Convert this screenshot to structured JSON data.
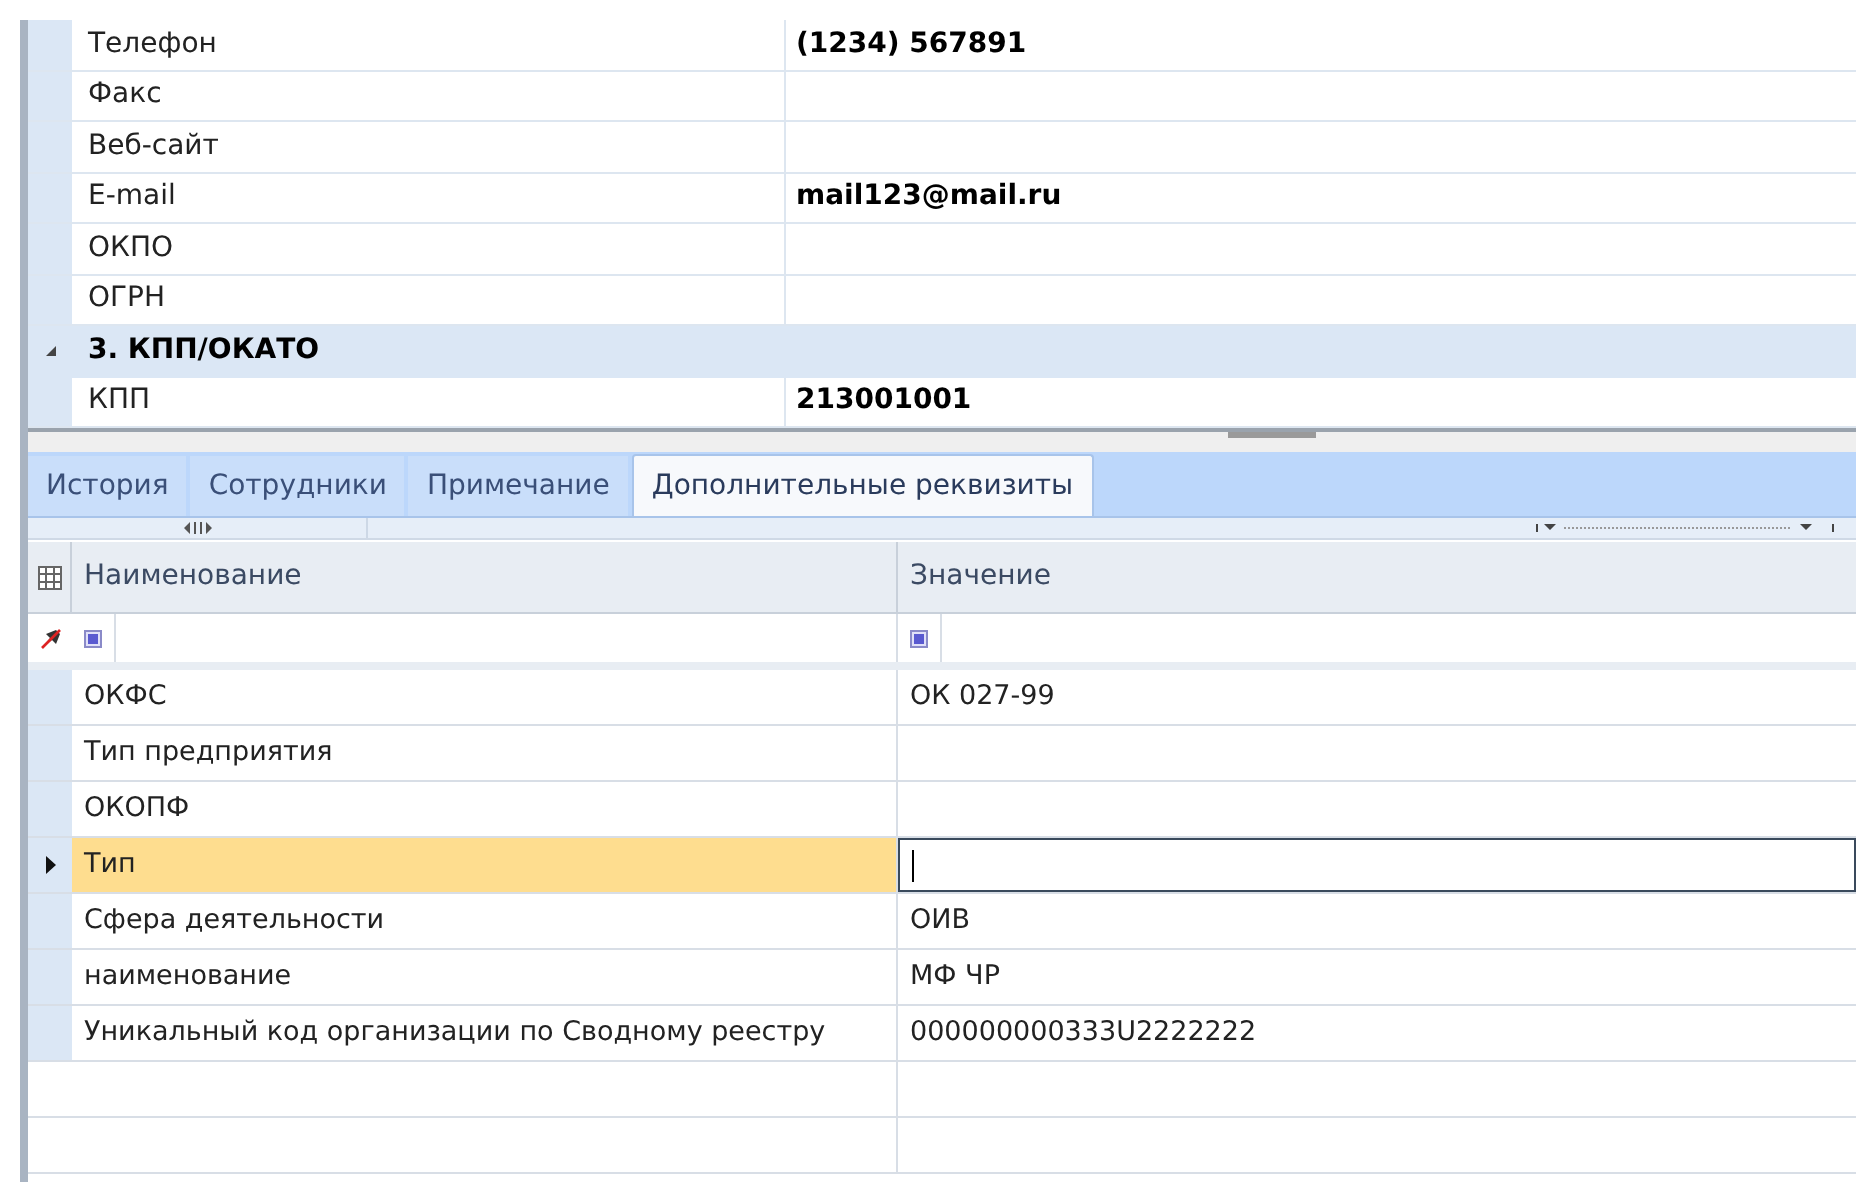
{
  "top_grid": {
    "rows": [
      {
        "kind": "field",
        "name": "Телефон",
        "value": "(1234) 567891"
      },
      {
        "kind": "field",
        "name": "Факс"
      },
      {
        "kind": "field",
        "name": "Веб-сайт"
      },
      {
        "kind": "field",
        "name": "E-mail",
        "value": "mail123@mail.ru"
      },
      {
        "kind": "field",
        "name": "ОКПО"
      },
      {
        "kind": "field",
        "name": "ОГРН"
      },
      {
        "kind": "group",
        "name": "3. КПП/ОКАТО",
        "expanded": true
      },
      {
        "kind": "field",
        "name": "КПП",
        "value": "213001001"
      }
    ]
  },
  "tabs": [
    {
      "label": "История",
      "selected": false
    },
    {
      "label": "Сотрудники",
      "selected": false
    },
    {
      "label": "Примечание",
      "selected": false
    },
    {
      "label": "Дополнительные реквизиты",
      "selected": true
    }
  ],
  "grid": {
    "columns": [
      "Наименование",
      "Значение"
    ],
    "rows": [
      {
        "name": "ОКФС",
        "value": "ОК 027-99",
        "selected": false
      },
      {
        "name": "Тип предприятия",
        "selected": false
      },
      {
        "name": "ОКОПФ",
        "selected": false
      },
      {
        "name": "Тип",
        "selected": true
      },
      {
        "name": "Сфера деятельности",
        "value": "ОИВ",
        "selected": false
      },
      {
        "name": "наименование",
        "value": "МФ ЧР",
        "selected": false
      },
      {
        "name": "Уникальный код организации по Сводному реестру",
        "value": "000000000333U2222222",
        "selected": false
      }
    ]
  }
}
